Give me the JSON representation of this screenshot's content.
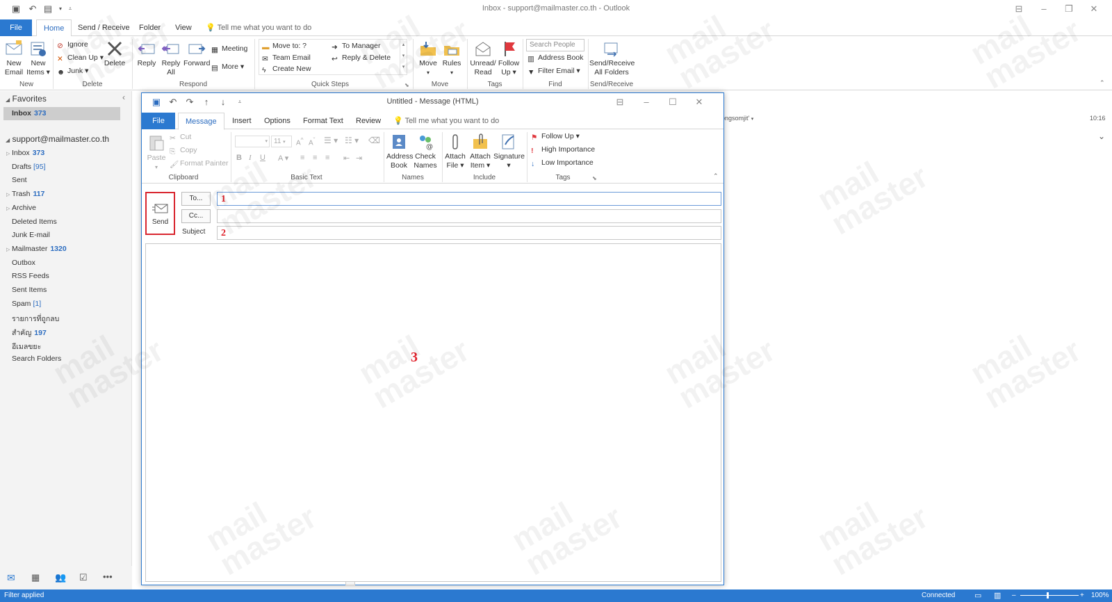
{
  "window": {
    "title": "Inbox - support@mailmaster.co.th  -  Outlook"
  },
  "tabs": {
    "file": "File",
    "home": "Home",
    "send_receive": "Send / Receive",
    "folder": "Folder",
    "view": "View",
    "tell": "Tell me what you want to do"
  },
  "ribbon": {
    "new_email": [
      "New",
      "Email"
    ],
    "new_items": [
      "New",
      "Items ▾"
    ],
    "ignore": "Ignore",
    "clean_up": "Clean Up ▾",
    "junk": "Junk ▾",
    "delete": "Delete",
    "reply": "Reply",
    "reply_all": [
      "Reply",
      "All"
    ],
    "forward": "Forward",
    "meeting": "Meeting",
    "more": "More ▾",
    "qs_move_to": "Move to: ?",
    "qs_team_email": "Team Email",
    "qs_create_new": "Create New",
    "qs_to_manager": "To Manager",
    "qs_reply_delete": "Reply & Delete",
    "move": "Move",
    "rules": "Rules",
    "unread_read": [
      "Unread/",
      "Read"
    ],
    "follow_up": [
      "Follow",
      "Up ▾"
    ],
    "search_people": "Search People",
    "address_book": "Address Book",
    "filter_email": "Filter Email ▾",
    "send_receive_all": [
      "Send/Receive",
      "All Folders"
    ],
    "groups": {
      "new": "New",
      "delete": "Delete",
      "respond": "Respond",
      "quick_steps": "Quick Steps",
      "move": "Move",
      "tags": "Tags",
      "find": "Find",
      "send_receive": "Send/Receive"
    }
  },
  "nav": {
    "favorites": "Favorites",
    "fav_inbox": "Inbox",
    "fav_inbox_count": "373",
    "account": "support@mailmaster.co.th",
    "folders": [
      {
        "label": "Inbox",
        "count": "373"
      },
      {
        "label": "Drafts",
        "count": "[95]"
      },
      {
        "label": "Sent",
        "count": ""
      },
      {
        "label": "Trash",
        "count": "117"
      },
      {
        "label": "Archive",
        "count": ""
      },
      {
        "label": "Deleted Items",
        "count": ""
      },
      {
        "label": "Junk E-mail",
        "count": ""
      },
      {
        "label": "Mailmaster",
        "count": "1320"
      },
      {
        "label": "Outbox",
        "count": ""
      },
      {
        "label": "RSS Feeds",
        "count": ""
      },
      {
        "label": "Sent Items",
        "count": ""
      },
      {
        "label": "Spam",
        "count": "[1]"
      },
      {
        "label": "รายการที่ถูกลบ",
        "count": ""
      },
      {
        "label": "สำคัญ",
        "count": "197"
      },
      {
        "label": "อีเมลขยะ",
        "count": ""
      },
      {
        "label": "Search Folders",
        "count": ""
      }
    ]
  },
  "reading": {
    "sender": "ongsomjit'",
    "time": "10:16"
  },
  "compose": {
    "title": "Untitled  -  Message (HTML)",
    "tabs": {
      "file": "File",
      "message": "Message",
      "insert": "Insert",
      "options": "Options",
      "format_text": "Format Text",
      "review": "Review",
      "tell": "Tell me what you want to do"
    },
    "ribbon": {
      "paste": "Paste",
      "cut": "Cut",
      "copy": "Copy",
      "format_painter": "Format Painter",
      "font_size": "11",
      "address_book": [
        "Address",
        "Book"
      ],
      "check_names": [
        "Check",
        "Names"
      ],
      "attach_file": [
        "Attach",
        "File ▾"
      ],
      "attach_item": [
        "Attach",
        "Item ▾"
      ],
      "signature": [
        "Signature",
        "▾"
      ],
      "follow_up": "Follow Up ▾",
      "high_importance": "High Importance",
      "low_importance": "Low Importance",
      "groups": {
        "clipboard": "Clipboard",
        "basic_text": "Basic Text",
        "names": "Names",
        "include": "Include",
        "tags": "Tags"
      }
    },
    "send": "Send",
    "to_btn": "To...",
    "cc_btn": "Cc...",
    "subject_label": "Subject",
    "to_value": "",
    "cc_value": "",
    "subject_value": "",
    "markers": [
      "1",
      "2",
      "3"
    ]
  },
  "status": {
    "left": "Filter applied",
    "connected": "Connected",
    "zoom": "100%"
  },
  "watermark": [
    "mail",
    "master"
  ]
}
